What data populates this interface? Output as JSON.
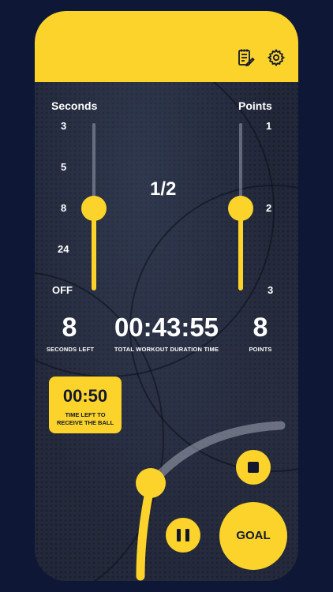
{
  "header": {
    "notes_icon": "notes-edit-icon",
    "settings_icon": "gear-icon",
    "color": "#fcd32a"
  },
  "seconds_slider": {
    "title": "Seconds",
    "ticks": [
      "3",
      "5",
      "8",
      "24",
      "OFF"
    ],
    "selected": "8"
  },
  "points_slider": {
    "title": "Points",
    "ticks": [
      "1",
      "2",
      "3"
    ],
    "selected": "2"
  },
  "ratio": "1/2",
  "stats": {
    "seconds_left": {
      "value": "8",
      "label": "SECONDS LEFT"
    },
    "total_duration": {
      "value": "00:43:55",
      "label": "TOTAL WORKOUT DURATION TIME"
    },
    "points": {
      "value": "8",
      "label": "POINTS"
    }
  },
  "receive_timer": {
    "value": "00:50",
    "label_line1": "TIME LEFT TO",
    "label_line2": "RECEIVE THE BALL"
  },
  "controls": {
    "goal_label": "GOAL",
    "stop_icon": "stop-icon",
    "pause_icon": "pause-icon"
  },
  "accent_color": "#fcd32a",
  "background_color": "#0e1836"
}
